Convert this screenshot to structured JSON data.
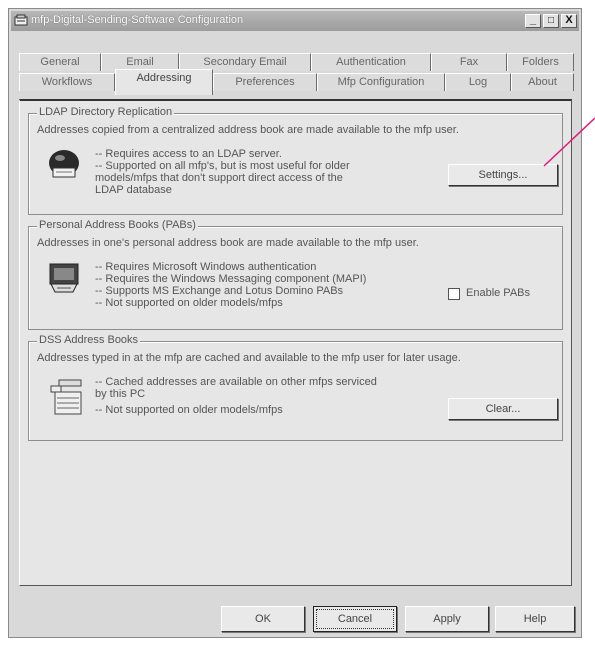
{
  "window": {
    "title": "mfp-Digital-Sending-Software Configuration",
    "min_glyph": "_",
    "max_glyph": "□",
    "close_glyph": "X"
  },
  "tabs": {
    "row1": [
      "General",
      "Email",
      "Secondary Email",
      "Authentication",
      "Fax",
      "Folders"
    ],
    "row2": [
      "Workflows",
      "Addressing",
      "Preferences",
      "Mfp Configuration",
      "Log",
      "About"
    ],
    "active": "Addressing"
  },
  "ldap": {
    "legend": "LDAP Directory Replication",
    "description": "Addresses copied from a centralized address book are made available to the mfp user.",
    "bullets": [
      "-- Requires access to an LDAP server.",
      "-- Supported on all mfp's, but is most useful for older",
      "models/mfps that don't support direct access of the",
      "LDAP database"
    ],
    "button": "Settings..."
  },
  "pab": {
    "legend": "Personal Address Books (PABs)",
    "description": "Addresses in one's personal address book are made available to the mfp user.",
    "bullets": [
      "-- Requires Microsoft Windows authentication",
      "-- Requires the Windows Messaging component (MAPI)",
      "-- Supports MS Exchange and Lotus Domino PABs",
      "-- Not supported on older models/mfps"
    ],
    "checkbox_label": "Enable PABs",
    "checkbox_checked": false
  },
  "dss": {
    "legend": "DSS Address Books",
    "description": "Addresses typed in at the mfp are cached and available to the mfp user for later usage.",
    "bullets": [
      "-- Cached addresses are available on other mfps serviced",
      "by this PC",
      "-- Not supported on older models/mfps"
    ],
    "button": "Clear..."
  },
  "footer": {
    "ok": "OK",
    "cancel": "Cancel",
    "apply": "Apply",
    "help": "Help"
  },
  "colors": {
    "callout_line": "#e0187a",
    "title_bar": "#a8a8a8",
    "face": "#e6e6e6"
  }
}
